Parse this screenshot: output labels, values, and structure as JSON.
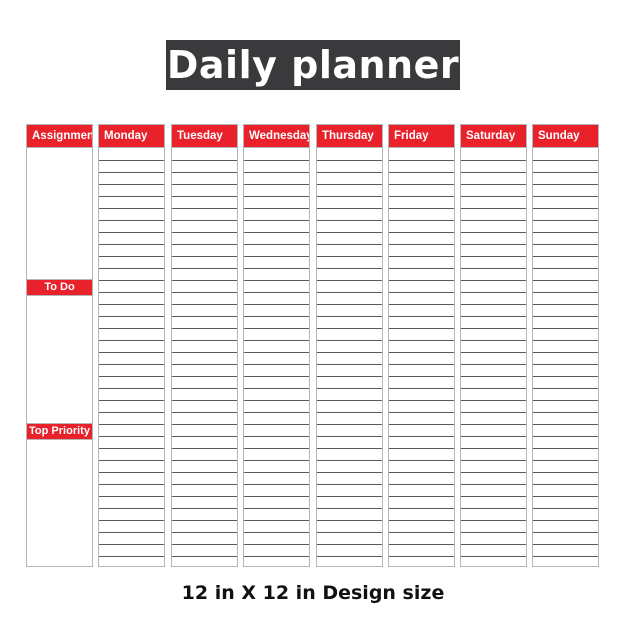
{
  "title": "Daily planner",
  "left_column": {
    "header": "Assignment",
    "sections": [
      "To Do",
      "Top Priority"
    ]
  },
  "days": [
    "Monday",
    "Tuesday",
    "Wednesday",
    "Thursday",
    "Friday",
    "Saturday",
    "Sunday"
  ],
  "rows_per_day": 35,
  "footer": "12 in X 12 in Design size",
  "colors": {
    "accent": "#e8212b",
    "title_bg": "#3a3a3c"
  }
}
